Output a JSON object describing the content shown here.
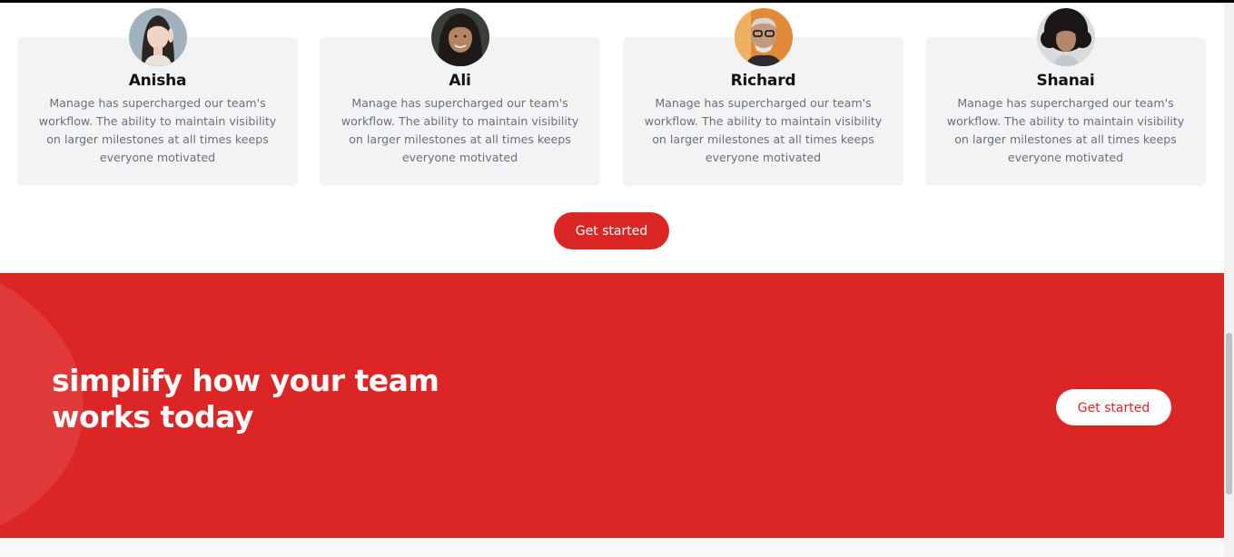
{
  "testimonials": [
    {
      "name": "Anisha",
      "quote": "Manage has supercharged our team's workflow. The ability to maintain visibility on larger milestones at all times keeps everyone motivated"
    },
    {
      "name": "Ali",
      "quote": "Manage has supercharged our team's workflow. The ability to maintain visibility on larger milestones at all times keeps everyone motivated"
    },
    {
      "name": "Richard",
      "quote": "Manage has supercharged our team's workflow. The ability to maintain visibility on larger milestones at all times keeps everyone motivated"
    },
    {
      "name": "Shanai",
      "quote": "Manage has supercharged our team's workflow. The ability to maintain visibility on larger milestones at all times keeps everyone motivated"
    }
  ],
  "testimonials_cta": {
    "label": "Get started"
  },
  "cta_banner": {
    "heading": "simplify how your team works today",
    "button_label": "Get started"
  },
  "colors": {
    "brand": "#dc2626",
    "card_bg": "#f2f3f5",
    "text_muted": "#6b6f78"
  }
}
